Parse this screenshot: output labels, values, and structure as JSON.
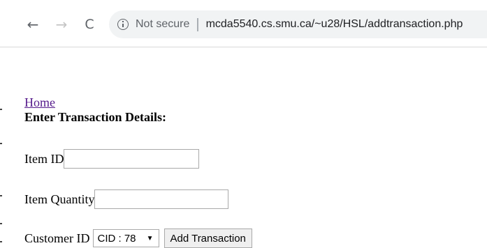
{
  "browser": {
    "back_icon": "←",
    "forward_icon": "→",
    "reload_icon": "C",
    "security_text": "Not secure",
    "separator": "|",
    "url": "mcda5540.cs.smu.ca/~u28/HSL/addtransaction.php"
  },
  "page": {
    "home_link": "Home",
    "heading": "Enter Transaction Details:",
    "item_id_label": "Item ID",
    "item_id_value": "",
    "item_quantity_label": "Item Quantity",
    "item_quantity_value": "",
    "customer_id_label": "Customer ID",
    "customer_id_selected": "CID : 78",
    "dropdown_arrow": "▼",
    "submit_label": "Add Transaction"
  }
}
